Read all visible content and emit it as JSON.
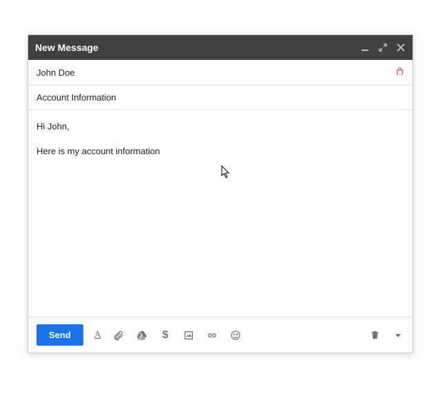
{
  "compose": {
    "title": "New Message",
    "to": "John Doe",
    "subject": "Account Information",
    "body_line1": "Hi John,",
    "body_line2": "Here is my account information",
    "send_label": "Send"
  }
}
